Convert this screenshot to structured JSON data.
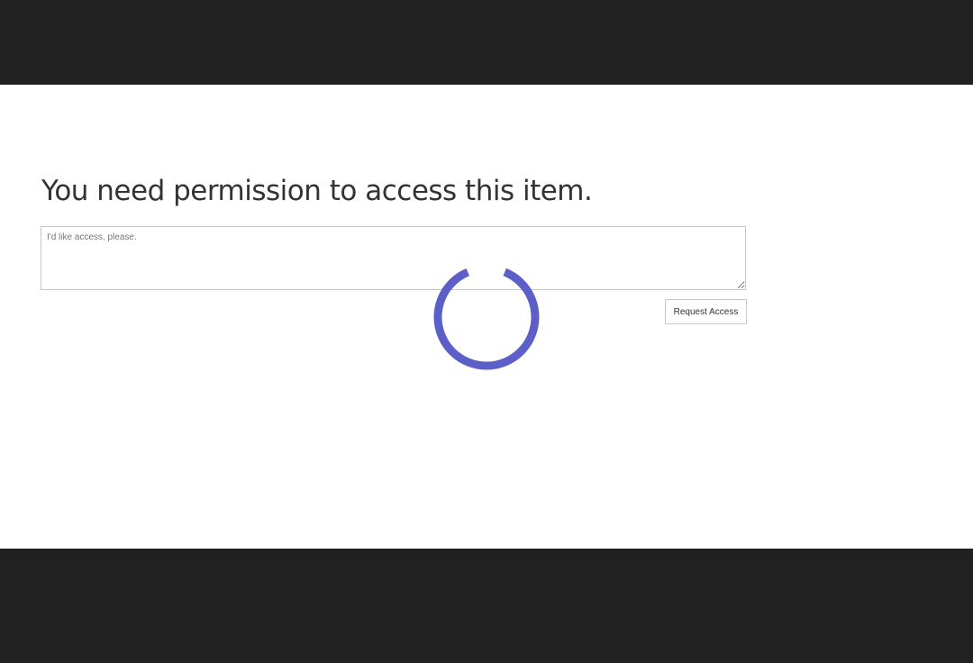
{
  "page": {
    "title": "You need permission to access this item."
  },
  "request_form": {
    "message_placeholder": "I'd like access, please.",
    "submit_label": "Request Access"
  },
  "loading": {
    "icon": "loading-spinner-icon",
    "color": "#5b5fc7"
  },
  "colors": {
    "frame_background": "#212121",
    "content_background": "#ffffff"
  }
}
